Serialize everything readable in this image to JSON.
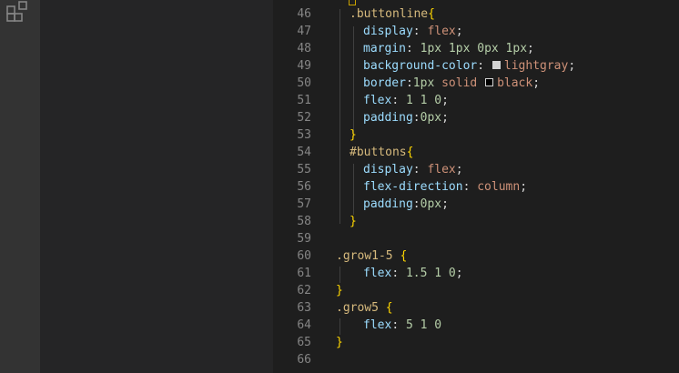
{
  "editor": {
    "lines": [
      {
        "num": "46",
        "tokens": [
          {
            "t": ".buttonline",
            "c": "sel"
          },
          {
            "t": "{",
            "c": "brace"
          }
        ]
      },
      {
        "num": "47",
        "tokens": [
          {
            "t": "display",
            "c": "prop"
          },
          {
            "t": ": ",
            "c": "punct"
          },
          {
            "t": "flex",
            "c": "str"
          },
          {
            "t": ";",
            "c": "punct"
          }
        ]
      },
      {
        "num": "48",
        "tokens": [
          {
            "t": "margin",
            "c": "prop"
          },
          {
            "t": ": ",
            "c": "punct"
          },
          {
            "t": "1px 1px 0px 1px",
            "c": "num"
          },
          {
            "t": ";",
            "c": "punct"
          }
        ]
      },
      {
        "num": "49",
        "tokens": [
          {
            "t": "background-color",
            "c": "prop"
          },
          {
            "t": ": ",
            "c": "punct"
          },
          {
            "t": "",
            "c": "swatch",
            "color": "#d3d3d3"
          },
          {
            "t": "lightgray",
            "c": "str"
          },
          {
            "t": ";",
            "c": "punct"
          }
        ]
      },
      {
        "num": "50",
        "tokens": [
          {
            "t": "border",
            "c": "prop"
          },
          {
            "t": ":",
            "c": "punct"
          },
          {
            "t": "1px",
            "c": "num"
          },
          {
            "t": " solid ",
            "c": "str"
          },
          {
            "t": "",
            "c": "swatch",
            "color": "#000000"
          },
          {
            "t": "black",
            "c": "str"
          },
          {
            "t": ";",
            "c": "punct"
          }
        ]
      },
      {
        "num": "51",
        "tokens": [
          {
            "t": "flex",
            "c": "prop"
          },
          {
            "t": ": ",
            "c": "punct"
          },
          {
            "t": "1 1 0",
            "c": "num"
          },
          {
            "t": ";",
            "c": "punct"
          }
        ]
      },
      {
        "num": "52",
        "tokens": [
          {
            "t": "padding",
            "c": "prop"
          },
          {
            "t": ":",
            "c": "punct"
          },
          {
            "t": "0px",
            "c": "num"
          },
          {
            "t": ";",
            "c": "punct"
          }
        ]
      },
      {
        "num": "53",
        "tokens": [
          {
            "t": "}",
            "c": "brace"
          }
        ]
      },
      {
        "num": "54",
        "tokens": [
          {
            "t": "#buttons",
            "c": "sel"
          },
          {
            "t": "{",
            "c": "brace"
          }
        ]
      },
      {
        "num": "55",
        "tokens": [
          {
            "t": "display",
            "c": "prop"
          },
          {
            "t": ": ",
            "c": "punct"
          },
          {
            "t": "flex",
            "c": "str"
          },
          {
            "t": ";",
            "c": "punct"
          }
        ]
      },
      {
        "num": "56",
        "tokens": [
          {
            "t": "flex-direction",
            "c": "prop"
          },
          {
            "t": ": ",
            "c": "punct"
          },
          {
            "t": "column",
            "c": "str"
          },
          {
            "t": ";",
            "c": "punct"
          }
        ]
      },
      {
        "num": "57",
        "tokens": [
          {
            "t": "padding",
            "c": "prop"
          },
          {
            "t": ":",
            "c": "punct"
          },
          {
            "t": "0px",
            "c": "num"
          },
          {
            "t": ";",
            "c": "punct"
          }
        ]
      },
      {
        "num": "58",
        "tokens": [
          {
            "t": "}",
            "c": "brace"
          }
        ]
      },
      {
        "num": "59",
        "tokens": []
      },
      {
        "num": "60",
        "tokens": [
          {
            "t": ".grow1-5",
            "c": "sel"
          },
          {
            "t": " ",
            "c": "punct"
          },
          {
            "t": "{",
            "c": "brace"
          }
        ]
      },
      {
        "num": "61",
        "tokens": [
          {
            "t": "flex",
            "c": "prop"
          },
          {
            "t": ": ",
            "c": "punct"
          },
          {
            "t": "1.5 1 0",
            "c": "num"
          },
          {
            "t": ";",
            "c": "punct"
          }
        ]
      },
      {
        "num": "62",
        "tokens": [
          {
            "t": "}",
            "c": "brace"
          }
        ]
      },
      {
        "num": "63",
        "tokens": [
          {
            "t": ".grow5",
            "c": "sel"
          },
          {
            "t": " ",
            "c": "punct"
          },
          {
            "t": "{",
            "c": "brace"
          }
        ]
      },
      {
        "num": "64",
        "tokens": [
          {
            "t": "flex",
            "c": "prop"
          },
          {
            "t": ": ",
            "c": "punct"
          },
          {
            "t": "5 1 0",
            "c": "num"
          }
        ]
      },
      {
        "num": "65",
        "tokens": [
          {
            "t": "}",
            "c": "brace"
          }
        ]
      },
      {
        "num": "66",
        "tokens": []
      }
    ]
  },
  "activity_bar": {
    "icon": "extensions-icon"
  }
}
